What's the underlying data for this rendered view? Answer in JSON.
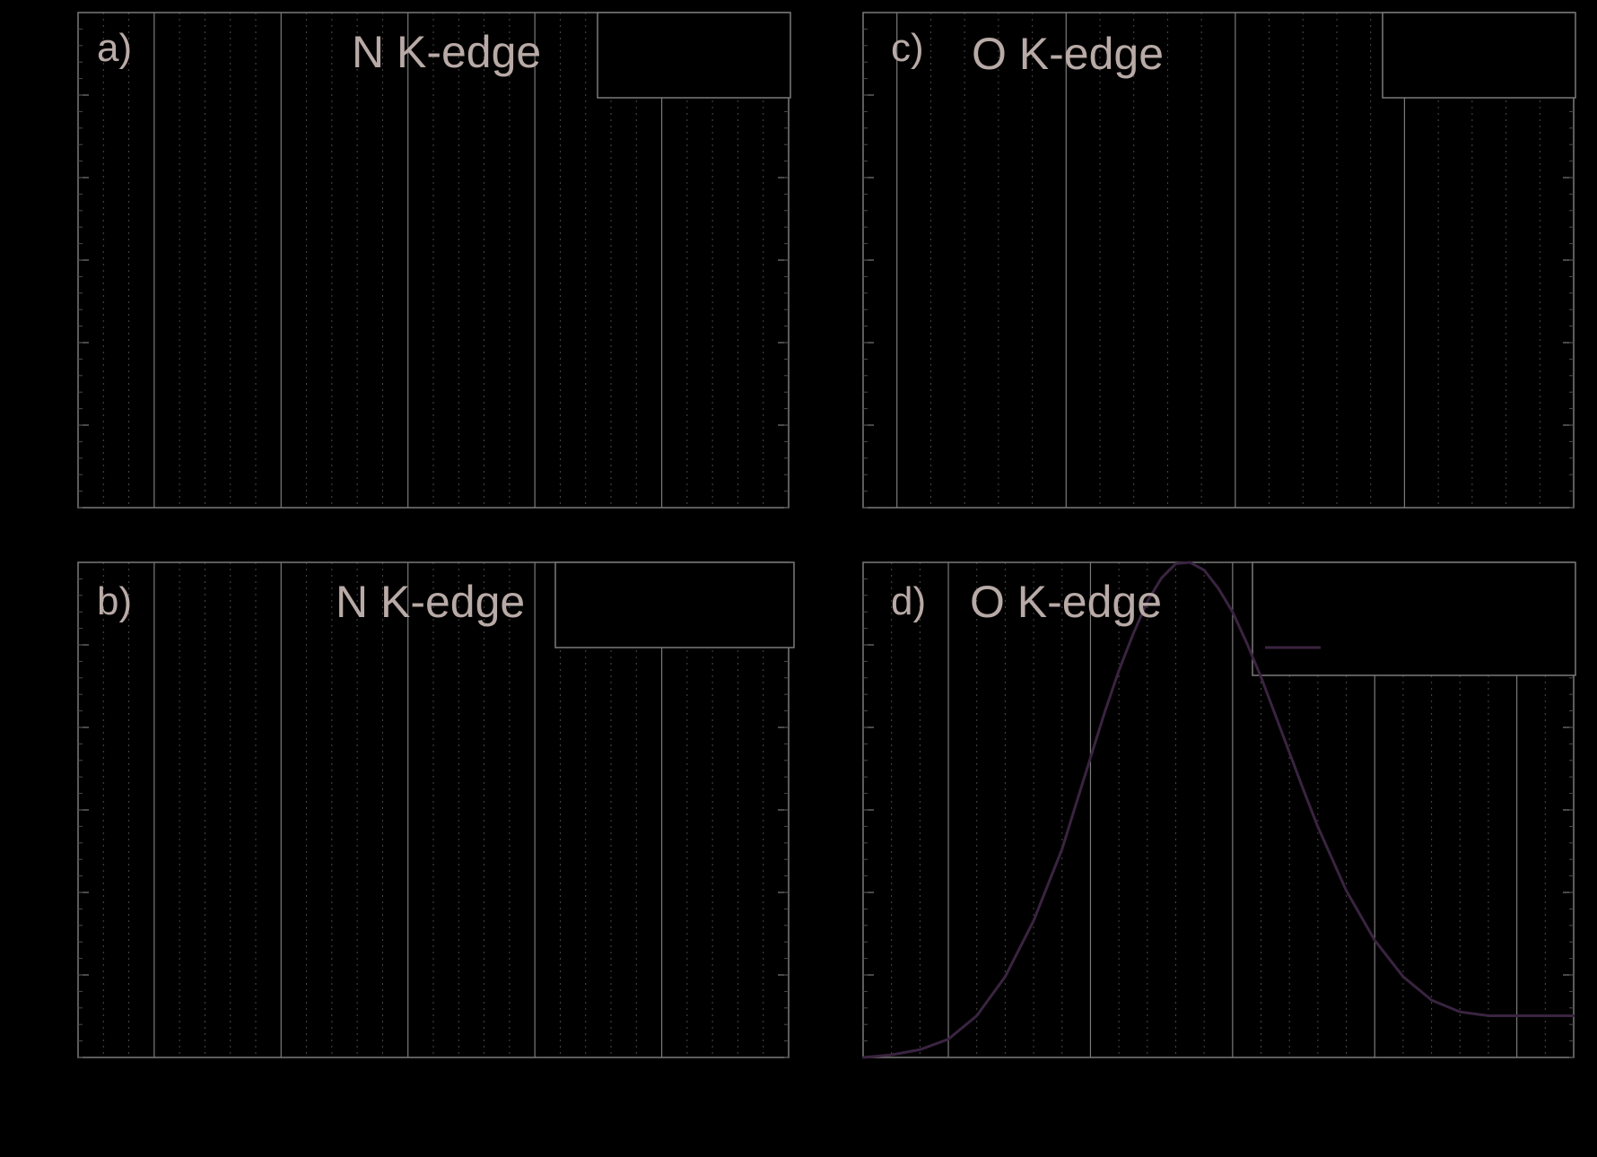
{
  "chart_data": [
    {
      "type": "line",
      "panel_label": "a)",
      "title": "N K-edge",
      "xlim": [
        0,
        28
      ],
      "ylim": [
        0,
        6
      ],
      "major_xticks": [
        3,
        8,
        13,
        18,
        23
      ],
      "series": []
    },
    {
      "type": "line",
      "panel_label": "b)",
      "title": "N K-edge",
      "xlim": [
        0,
        28
      ],
      "ylim": [
        0,
        3.4
      ],
      "major_xticks": [
        3,
        8,
        13,
        18,
        23
      ],
      "series": []
    },
    {
      "type": "line",
      "panel_label": "c)",
      "title": "O K-edge",
      "xlim": [
        0,
        21
      ],
      "ylim": [
        0,
        8
      ],
      "major_xticks": [
        1,
        6,
        11,
        16
      ],
      "series": []
    },
    {
      "type": "line",
      "panel_label": "d)",
      "title": "O K-edge",
      "xlim": [
        0,
        25
      ],
      "ylim": [
        0,
        3.8
      ],
      "major_xticks": [
        3,
        8,
        13,
        18,
        23
      ],
      "series": [
        {
          "color": "#3a2440",
          "x": [
            0,
            1,
            2,
            3,
            4,
            5,
            6,
            7,
            7.5,
            8,
            8.5,
            9,
            9.5,
            10,
            10.5,
            11,
            11.5,
            12,
            12.5,
            13,
            13.5,
            14,
            14.5,
            15,
            15.5,
            16,
            17,
            18,
            19,
            20,
            21,
            22,
            23,
            24,
            25
          ],
          "y": [
            0.0,
            0.02,
            0.06,
            0.14,
            0.32,
            0.62,
            1.05,
            1.6,
            1.95,
            2.3,
            2.65,
            2.97,
            3.25,
            3.5,
            3.68,
            3.79,
            3.8,
            3.74,
            3.6,
            3.42,
            3.18,
            2.92,
            2.63,
            2.34,
            2.05,
            1.77,
            1.28,
            0.9,
            0.62,
            0.44,
            0.35,
            0.32,
            0.32,
            0.32,
            0.32
          ]
        }
      ]
    }
  ],
  "legend_line_color": "#3a2440"
}
